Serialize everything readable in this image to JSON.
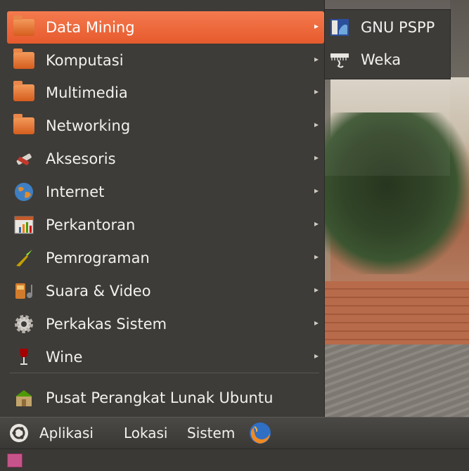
{
  "menu": {
    "items": [
      {
        "label": "Data Mining",
        "icon": "folder-icon",
        "active": true
      },
      {
        "label": "Komputasi",
        "icon": "folder-icon"
      },
      {
        "label": "Multimedia",
        "icon": "folder-icon"
      },
      {
        "label": "Networking",
        "icon": "folder-icon"
      },
      {
        "label": "Aksesoris",
        "icon": "accessories-icon"
      },
      {
        "label": "Internet",
        "icon": "globe-icon"
      },
      {
        "label": "Perkantoran",
        "icon": "office-chart-icon"
      },
      {
        "label": "Pemrograman",
        "icon": "trowel-icon"
      },
      {
        "label": "Suara & Video",
        "icon": "media-icon"
      },
      {
        "label": "Perkakas Sistem",
        "icon": "gear-icon"
      },
      {
        "label": "Wine",
        "icon": "wine-glass-icon"
      }
    ],
    "software_center": {
      "label": "Pusat Perangkat Lunak Ubuntu",
      "icon": "software-center-icon"
    },
    "arrow_glyph": "▸"
  },
  "submenu": {
    "items": [
      {
        "label": "GNU PSPP",
        "icon": "pspp-icon"
      },
      {
        "label": "Weka",
        "icon": "weka-icon"
      }
    ]
  },
  "panel": {
    "applications": "Aplikasi",
    "places": "Lokasi",
    "system": "Sistem",
    "firefox_icon": "firefox-icon"
  },
  "colors": {
    "accent": "#e65a2d",
    "menu_bg": "#3e3c38"
  }
}
